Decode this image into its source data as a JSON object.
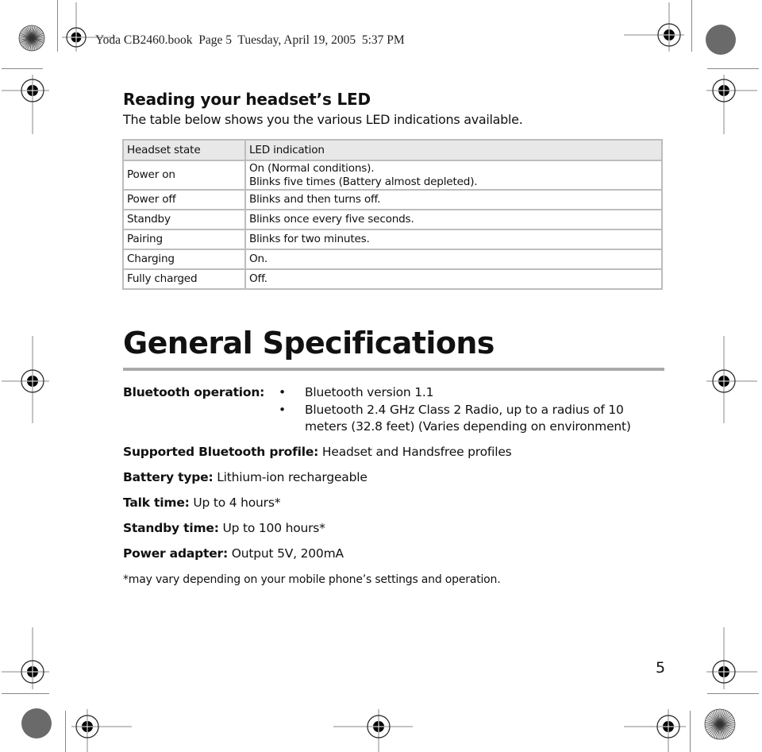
{
  "print_header": "Yoda CB2460.book  Page 5  Tuesday, April 19, 2005  5:37 PM",
  "led_section": {
    "title": "Reading your headset’s LED",
    "intro": "The table below shows you the various LED indications available.",
    "table": {
      "headers": [
        "Headset state",
        "LED indication"
      ],
      "rows": [
        {
          "state": "Power on",
          "indication": [
            "On (Normal conditions).",
            "Blinks five times (Battery almost depleted)."
          ]
        },
        {
          "state": "Power off",
          "indication": [
            "Blinks and then turns off."
          ]
        },
        {
          "state": "Standby",
          "indication": [
            "Blinks once every five seconds."
          ]
        },
        {
          "state": "Pairing",
          "indication": [
            "Blinks for two minutes."
          ]
        },
        {
          "state": "Charging",
          "indication": [
            "On."
          ]
        },
        {
          "state": "Fully charged",
          "indication": [
            "Off."
          ]
        }
      ]
    }
  },
  "specs": {
    "title": "General Specifications",
    "bluetooth_operation": {
      "label": "Bluetooth operation:",
      "bullet": "•",
      "items": [
        "Bluetooth version 1.1",
        "Bluetooth 2.4 GHz Class 2 Radio, up to a radius of 10",
        " meters (32.8 feet) (Varies depending on environment)"
      ]
    },
    "items": [
      {
        "label": "Supported Bluetooth profile:",
        "value": " Headset and Handsfree profiles"
      },
      {
        "label": "Battery type:",
        "value": " Lithium-ion rechargeable"
      },
      {
        "label": "Talk time:",
        "value": " Up to 4 hours*"
      },
      {
        "label": "Standby time:",
        "value": " Up to 100 hours*"
      },
      {
        "label": "Power adapter:",
        "value": " Output 5V, 200mA"
      }
    ],
    "footnote": "*may vary depending on your mobile phone’s settings and operation."
  },
  "page_number": "5",
  "marks": {
    "registration_icon": "registration-target-icon",
    "color_bar_icon": "starburst-icon",
    "gray_disc_icon": "gray-disc-icon"
  }
}
